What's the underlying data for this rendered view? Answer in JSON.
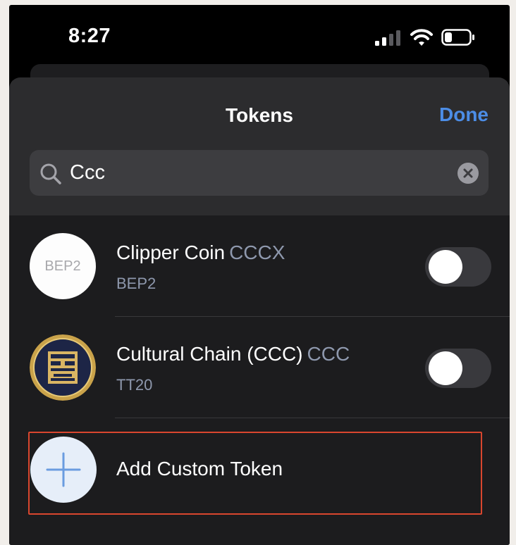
{
  "status_bar": {
    "time": "8:27",
    "signal_icon": "cellular-signal-icon",
    "wifi_icon": "wifi-icon",
    "battery_icon": "battery-icon"
  },
  "header": {
    "title": "Tokens",
    "done_label": "Done"
  },
  "search": {
    "value": "Ccc",
    "placeholder": "",
    "search_icon": "search-icon",
    "clear_icon": "clear-icon"
  },
  "tokens": [
    {
      "name": "Clipper Coin",
      "symbol": "CCCX",
      "network": "BEP2",
      "avatar_text": "BEP2",
      "enabled": false
    },
    {
      "name": "Cultural Chain (CCC)",
      "symbol": "CCC",
      "network": "TT20",
      "avatar_icon": "cultural-chain-logo-icon",
      "enabled": false
    }
  ],
  "add_custom": {
    "label": "Add Custom Token",
    "icon": "plus-icon"
  },
  "colors": {
    "accent": "#4c8de6",
    "sheet_bg": "#2c2c2e",
    "list_bg": "#1c1c1e",
    "highlight": "#d9462e"
  }
}
